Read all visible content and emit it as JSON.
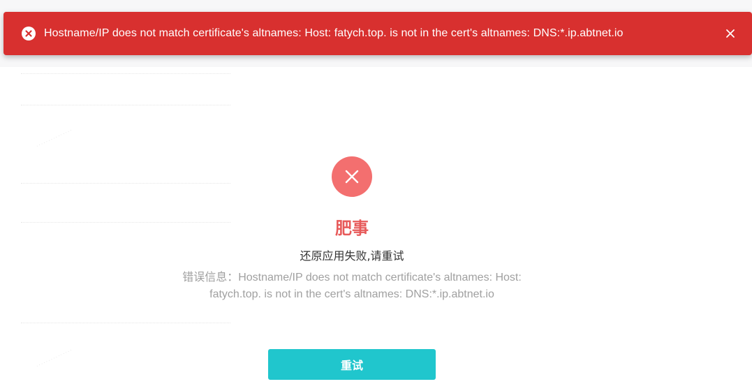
{
  "toast": {
    "message": "Hostname/IP does not match certificate's altnames: Host: fatych.top. is not in the cert's altnames: DNS:*.ip.abtnet.io",
    "icon": "error-circle-icon",
    "close_icon": "close-icon",
    "color": "#d8302f"
  },
  "result": {
    "icon": "close-icon",
    "icon_color": "#f36f6f",
    "title": "肥事",
    "subtitle": "还原应用失败,请重试",
    "error_detail": "错误信息：Hostname/IP does not match certificate's altnames: Host: fatych.top. is not in the cert's altnames: DNS:*.ip.abtnet.io"
  },
  "actions": {
    "retry_label": "重试",
    "retry_color": "#20c6cd"
  }
}
